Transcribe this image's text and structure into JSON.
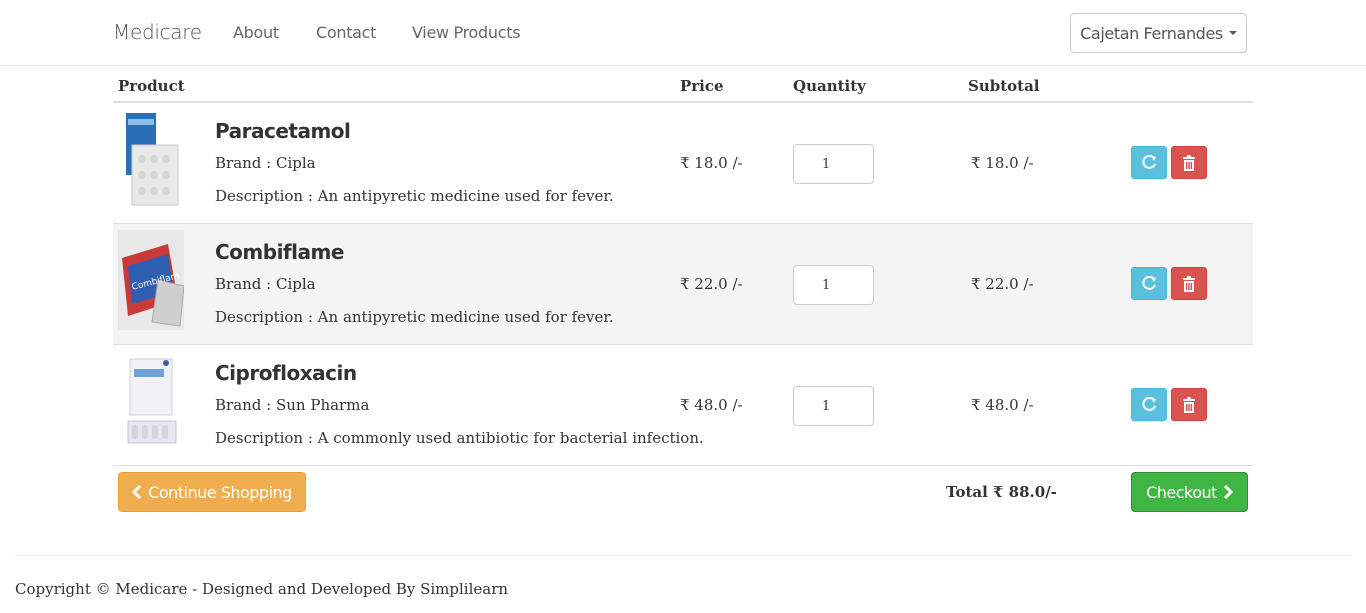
{
  "nav": {
    "brand": "Medicare",
    "links": [
      "About",
      "Contact",
      "View Products"
    ],
    "user": "Cajetan Fernandes"
  },
  "table": {
    "headers": [
      "Product",
      "Price",
      "Quantity",
      "Subtotal"
    ]
  },
  "items": [
    {
      "name": "Paracetamol",
      "brand": "Brand : Cipla",
      "description": "Description : An antipyretic medicine used for fever.",
      "price": "₹ 18.0 /-",
      "quantity": "1",
      "subtotal": "₹ 18.0 /-"
    },
    {
      "name": "Combiflame",
      "brand": "Brand : Cipla",
      "description": "Description : An antipyretic medicine used for fever.",
      "price": "₹ 22.0 /-",
      "quantity": "1",
      "subtotal": "₹ 22.0 /-"
    },
    {
      "name": "Ciprofloxacin",
      "brand": "Brand : Sun Pharma",
      "description": "Description : A commonly used antibiotic for bacterial infection.",
      "price": "₹ 48.0 /-",
      "quantity": "1",
      "subtotal": "₹ 48.0 /-"
    }
  ],
  "summary": {
    "continue_label": "Continue Shopping",
    "total": "Total ₹ 88.0/-",
    "checkout_label": "Checkout"
  },
  "footer": {
    "copyright": "Copyright © Medicare - Designed and Developed By Simplilearn"
  },
  "colors": {
    "info": "#5bc0de",
    "danger": "#d9534f",
    "warning": "#f0ad4e",
    "success": "#3fb644"
  },
  "icons": {
    "refresh": "refresh-icon",
    "delete": "trash-icon",
    "continue": "chevron-left-icon",
    "checkout": "chevron-right-icon",
    "user_menu": "caret-down-icon"
  }
}
